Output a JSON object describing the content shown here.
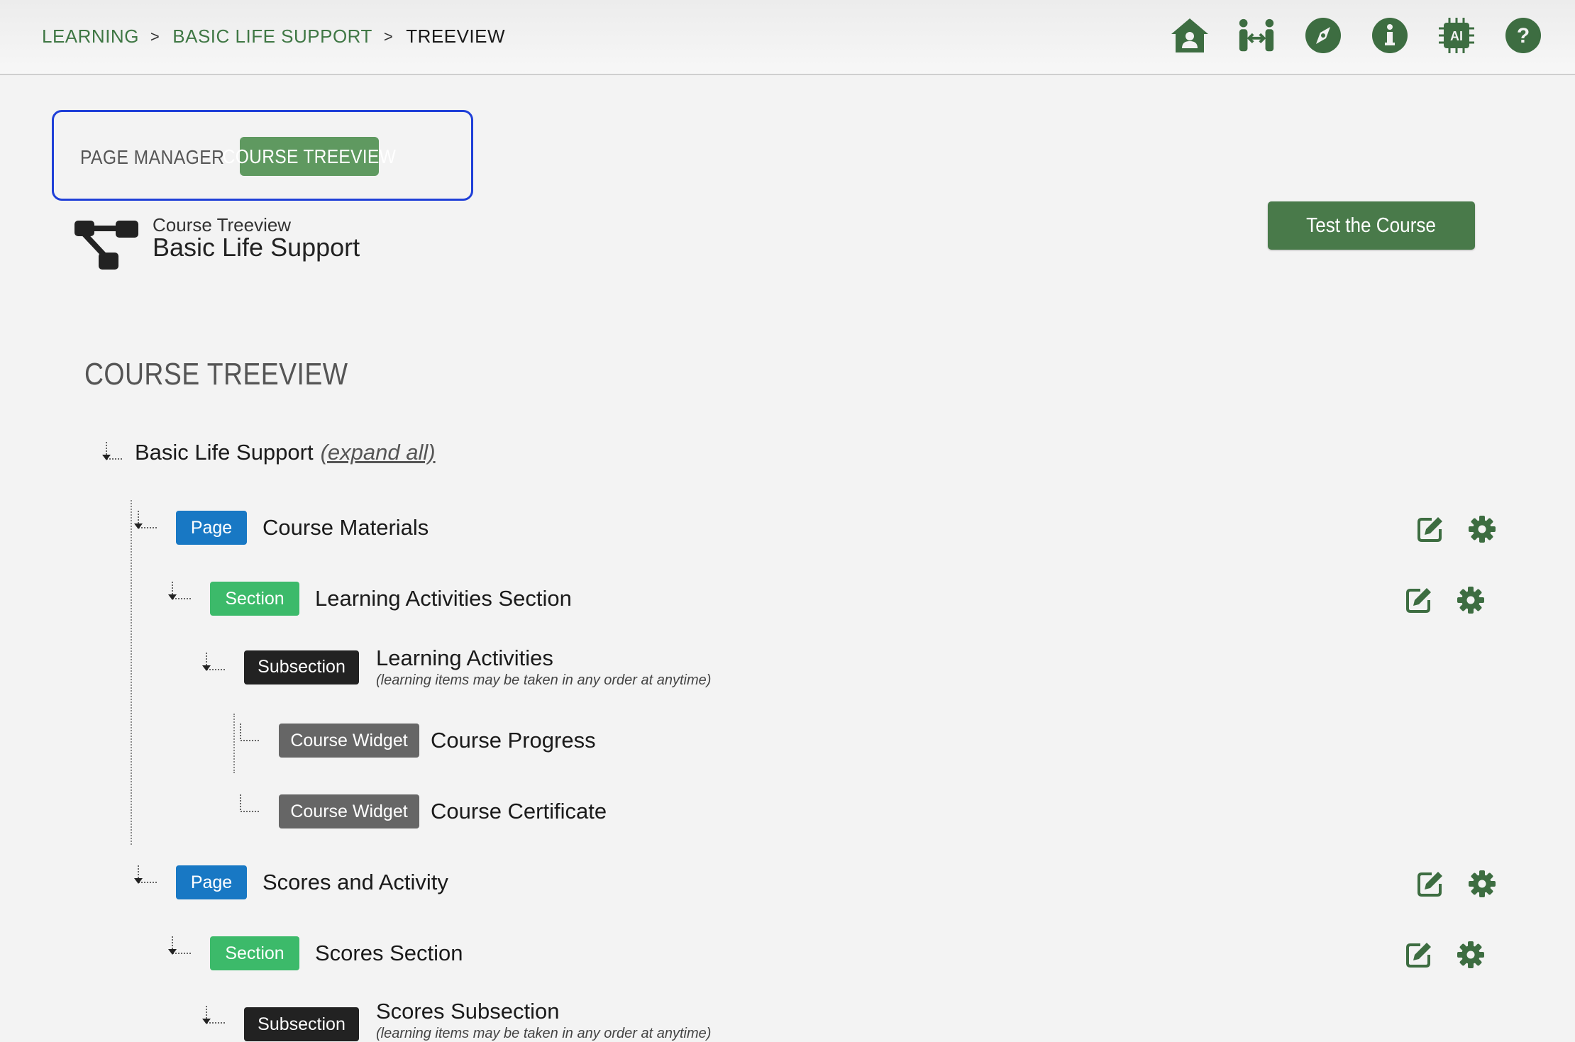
{
  "breadcrumb": {
    "items": [
      "LEARNING",
      "BASIC LIFE SUPPORT"
    ],
    "separator": ">",
    "current": "TREEVIEW"
  },
  "top_icons": [
    "home-icon",
    "people-connect-icon",
    "compass-icon",
    "info-icon",
    "ai-chip-icon",
    "help-icon"
  ],
  "tabs": {
    "page_manager": "PAGE MANAGER",
    "course_treeview": "COURSE TREEVIEW"
  },
  "header": {
    "subtitle": "Course Treeview",
    "title": "Basic Life Support",
    "test_button": "Test the Course"
  },
  "section_title": "COURSE TREEVIEW",
  "tree": {
    "root_label": "Basic Life Support",
    "expand_all": "(expand all)",
    "nodes": [
      {
        "badge": "Page",
        "label": "Course Materials"
      },
      {
        "badge": "Section",
        "label": "Learning Activities Section"
      },
      {
        "badge": "Subsection",
        "label": "Learning Activities",
        "note": "(learning items may be taken in any order at anytime)"
      },
      {
        "badge": "Course Widget",
        "label": "Course Progress"
      },
      {
        "badge": "Course Widget",
        "label": "Course Certificate"
      },
      {
        "badge": "Page",
        "label": "Scores and Activity"
      },
      {
        "badge": "Section",
        "label": "Scores Section"
      },
      {
        "badge": "Subsection",
        "label": "Scores Subsection",
        "note": "(learning items may be taken in any order at anytime)"
      }
    ]
  },
  "colors": {
    "accent_green": "#497a4a",
    "tab_green": "#5f9960",
    "page_blue": "#1878c4",
    "section_green": "#3cba6a",
    "subsection_black": "#222222",
    "widget_gray": "#666666",
    "focus_border": "#1f3fd8"
  }
}
